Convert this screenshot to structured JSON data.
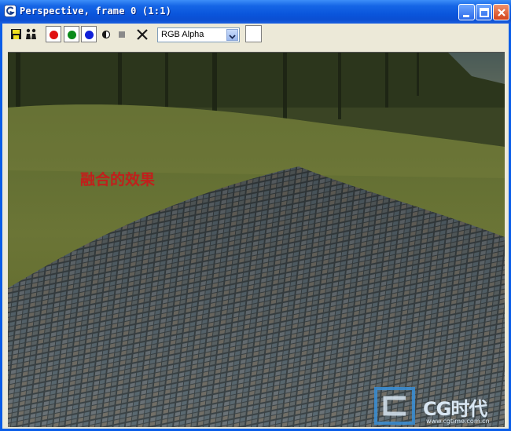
{
  "window": {
    "title": "Perspective, frame 0 (1:1)"
  },
  "title_buttons": {
    "minimize": "minimize-icon",
    "maximize": "maximize-icon",
    "close": "close-icon"
  },
  "toolbar": {
    "tools": [
      "save-icon",
      "clone-icon"
    ],
    "channels": [
      {
        "name": "red-channel",
        "color": "#e01010"
      },
      {
        "name": "green-channel",
        "color": "#0a8a1a"
      },
      {
        "name": "blue-channel",
        "color": "#1020d8"
      }
    ],
    "channel_select": {
      "selected": "RGB Alpha"
    },
    "swatch_color": "#ffffff"
  },
  "viewport": {
    "overlay_text": "融合的效果",
    "watermark": {
      "brand": "CG时代",
      "url": "www.cgtime.com.cn"
    }
  }
}
